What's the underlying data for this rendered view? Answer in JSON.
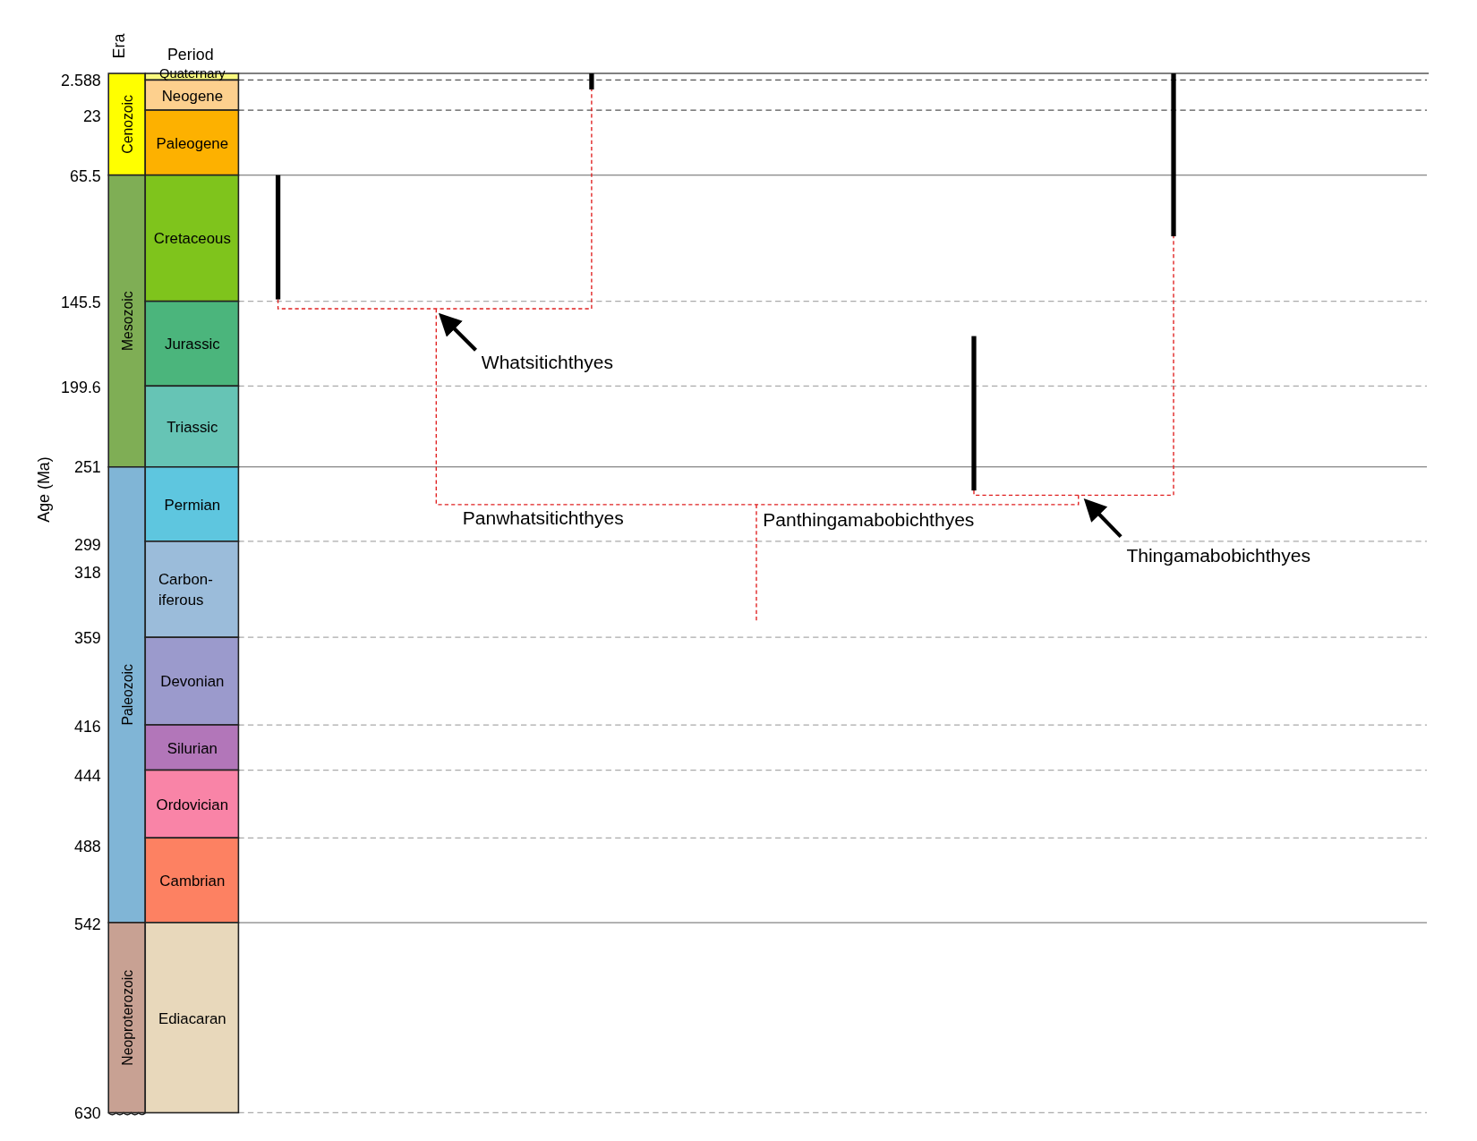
{
  "axis": {
    "title": "Age (Ma)",
    "era_heading": "Era",
    "period_heading": "Period"
  },
  "age_ticks": [
    {
      "label": "2.588",
      "kind": "dashed"
    },
    {
      "label": "23",
      "kind": "dashed"
    },
    {
      "label": "65.5",
      "kind": "solid"
    },
    {
      "label": "145.5",
      "kind": "dashed"
    },
    {
      "label": "199.6",
      "kind": "dashed"
    },
    {
      "label": "251",
      "kind": "solid"
    },
    {
      "label": "299",
      "kind": "dashed"
    },
    {
      "label": "318",
      "kind": "label_only"
    },
    {
      "label": "359",
      "kind": "dashed"
    },
    {
      "label": "416",
      "kind": "dashed"
    },
    {
      "label": "444",
      "kind": "dashed"
    },
    {
      "label": "488",
      "kind": "dashed"
    },
    {
      "label": "542",
      "kind": "solid"
    },
    {
      "label": "630",
      "kind": "dashed"
    }
  ],
  "eras": [
    {
      "name": "Cenozoic",
      "color": "#ffff00"
    },
    {
      "name": "Mesozoic",
      "color": "#7fae55"
    },
    {
      "name": "Paleozoic",
      "color": "#80b5d6"
    },
    {
      "name": "Neoproterozoic",
      "color": "#c8a193"
    }
  ],
  "periods": [
    {
      "lines": [
        "Quaternary"
      ],
      "color": "#f9f97f"
    },
    {
      "lines": [
        "Neogene"
      ],
      "color": "#fdd08e"
    },
    {
      "lines": [
        "Paleogene"
      ],
      "color": "#fdb100"
    },
    {
      "lines": [
        "Cretaceous"
      ],
      "color": "#7fc41c"
    },
    {
      "lines": [
        "Jurassic"
      ],
      "color": "#4bb57c"
    },
    {
      "lines": [
        "Triassic"
      ],
      "color": "#66c4b5"
    },
    {
      "lines": [
        "Permian"
      ],
      "color": "#5ec6df"
    },
    {
      "lines": [
        "Carbon-",
        "iferous"
      ],
      "color": "#9bbcda"
    },
    {
      "lines": [
        "Devonian"
      ],
      "color": "#9b9acc"
    },
    {
      "lines": [
        "Silurian"
      ],
      "color": "#b276b9"
    },
    {
      "lines": [
        "Ordovician"
      ],
      "color": "#f984a7"
    },
    {
      "lines": [
        "Cambrian"
      ],
      "color": "#fd8162"
    },
    {
      "lines": [
        "Ediacaran"
      ],
      "color": "#e8d8bb"
    }
  ],
  "clades": [
    {
      "name": "Whatsitichthyes",
      "kind": "arrowed"
    },
    {
      "name": "Panwhatsitichthyes",
      "kind": "plain"
    },
    {
      "name": "Panthingamabobichthyes",
      "kind": "plain"
    },
    {
      "name": "Thingamabobichthyes",
      "kind": "arrowed"
    }
  ]
}
